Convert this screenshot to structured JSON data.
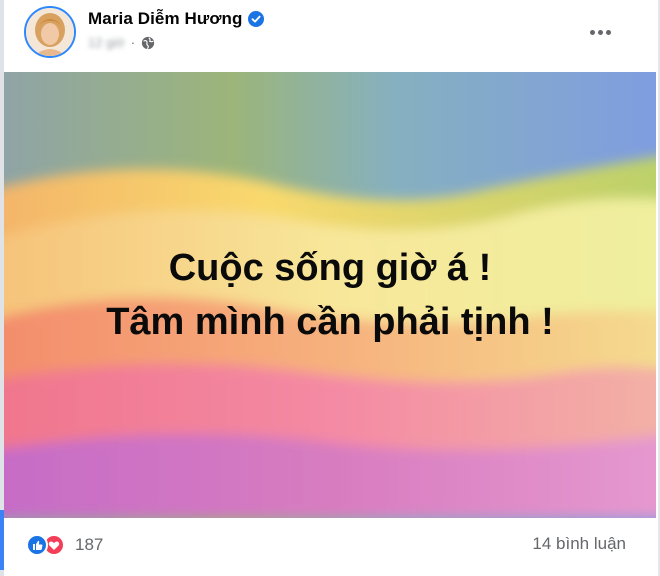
{
  "post": {
    "author": "Maria Diễm Hương",
    "verified": true,
    "time": "12 giờ",
    "separator": "·",
    "privacy_icon": "globe-icon",
    "more_icon": "more-options-icon",
    "text_lines": [
      "Cuộc sống giờ á !",
      "Tâm mình cần phải tịnh !"
    ]
  },
  "footer": {
    "reaction_icons": [
      "like-icon",
      "love-icon"
    ],
    "reaction_count": "187",
    "comments": "14 bình luận"
  },
  "colors": {
    "verified_blue": "#1b74e4",
    "like_blue": "#1b74e4",
    "love_red": "#f33e58",
    "secondary_text": "#65676b"
  }
}
